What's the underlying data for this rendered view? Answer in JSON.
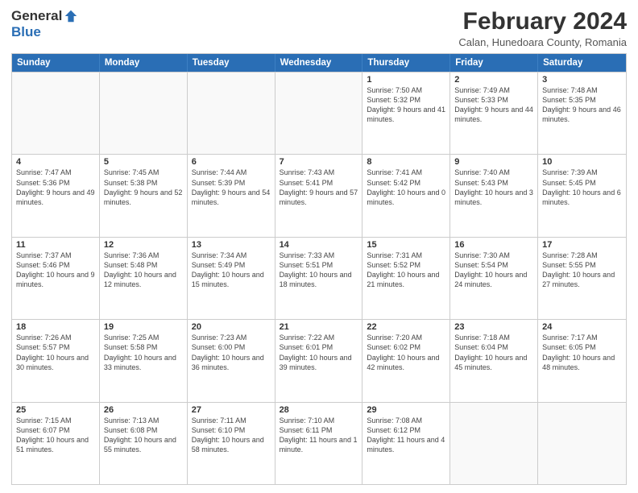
{
  "logo": {
    "general": "General",
    "blue": "Blue"
  },
  "header": {
    "month": "February 2024",
    "location": "Calan, Hunedoara County, Romania"
  },
  "weekdays": [
    "Sunday",
    "Monday",
    "Tuesday",
    "Wednesday",
    "Thursday",
    "Friday",
    "Saturday"
  ],
  "weeks": [
    [
      {
        "day": "",
        "info": ""
      },
      {
        "day": "",
        "info": ""
      },
      {
        "day": "",
        "info": ""
      },
      {
        "day": "",
        "info": ""
      },
      {
        "day": "1",
        "info": "Sunrise: 7:50 AM\nSunset: 5:32 PM\nDaylight: 9 hours and 41 minutes."
      },
      {
        "day": "2",
        "info": "Sunrise: 7:49 AM\nSunset: 5:33 PM\nDaylight: 9 hours and 44 minutes."
      },
      {
        "day": "3",
        "info": "Sunrise: 7:48 AM\nSunset: 5:35 PM\nDaylight: 9 hours and 46 minutes."
      }
    ],
    [
      {
        "day": "4",
        "info": "Sunrise: 7:47 AM\nSunset: 5:36 PM\nDaylight: 9 hours and 49 minutes."
      },
      {
        "day": "5",
        "info": "Sunrise: 7:45 AM\nSunset: 5:38 PM\nDaylight: 9 hours and 52 minutes."
      },
      {
        "day": "6",
        "info": "Sunrise: 7:44 AM\nSunset: 5:39 PM\nDaylight: 9 hours and 54 minutes."
      },
      {
        "day": "7",
        "info": "Sunrise: 7:43 AM\nSunset: 5:41 PM\nDaylight: 9 hours and 57 minutes."
      },
      {
        "day": "8",
        "info": "Sunrise: 7:41 AM\nSunset: 5:42 PM\nDaylight: 10 hours and 0 minutes."
      },
      {
        "day": "9",
        "info": "Sunrise: 7:40 AM\nSunset: 5:43 PM\nDaylight: 10 hours and 3 minutes."
      },
      {
        "day": "10",
        "info": "Sunrise: 7:39 AM\nSunset: 5:45 PM\nDaylight: 10 hours and 6 minutes."
      }
    ],
    [
      {
        "day": "11",
        "info": "Sunrise: 7:37 AM\nSunset: 5:46 PM\nDaylight: 10 hours and 9 minutes."
      },
      {
        "day": "12",
        "info": "Sunrise: 7:36 AM\nSunset: 5:48 PM\nDaylight: 10 hours and 12 minutes."
      },
      {
        "day": "13",
        "info": "Sunrise: 7:34 AM\nSunset: 5:49 PM\nDaylight: 10 hours and 15 minutes."
      },
      {
        "day": "14",
        "info": "Sunrise: 7:33 AM\nSunset: 5:51 PM\nDaylight: 10 hours and 18 minutes."
      },
      {
        "day": "15",
        "info": "Sunrise: 7:31 AM\nSunset: 5:52 PM\nDaylight: 10 hours and 21 minutes."
      },
      {
        "day": "16",
        "info": "Sunrise: 7:30 AM\nSunset: 5:54 PM\nDaylight: 10 hours and 24 minutes."
      },
      {
        "day": "17",
        "info": "Sunrise: 7:28 AM\nSunset: 5:55 PM\nDaylight: 10 hours and 27 minutes."
      }
    ],
    [
      {
        "day": "18",
        "info": "Sunrise: 7:26 AM\nSunset: 5:57 PM\nDaylight: 10 hours and 30 minutes."
      },
      {
        "day": "19",
        "info": "Sunrise: 7:25 AM\nSunset: 5:58 PM\nDaylight: 10 hours and 33 minutes."
      },
      {
        "day": "20",
        "info": "Sunrise: 7:23 AM\nSunset: 6:00 PM\nDaylight: 10 hours and 36 minutes."
      },
      {
        "day": "21",
        "info": "Sunrise: 7:22 AM\nSunset: 6:01 PM\nDaylight: 10 hours and 39 minutes."
      },
      {
        "day": "22",
        "info": "Sunrise: 7:20 AM\nSunset: 6:02 PM\nDaylight: 10 hours and 42 minutes."
      },
      {
        "day": "23",
        "info": "Sunrise: 7:18 AM\nSunset: 6:04 PM\nDaylight: 10 hours and 45 minutes."
      },
      {
        "day": "24",
        "info": "Sunrise: 7:17 AM\nSunset: 6:05 PM\nDaylight: 10 hours and 48 minutes."
      }
    ],
    [
      {
        "day": "25",
        "info": "Sunrise: 7:15 AM\nSunset: 6:07 PM\nDaylight: 10 hours and 51 minutes."
      },
      {
        "day": "26",
        "info": "Sunrise: 7:13 AM\nSunset: 6:08 PM\nDaylight: 10 hours and 55 minutes."
      },
      {
        "day": "27",
        "info": "Sunrise: 7:11 AM\nSunset: 6:10 PM\nDaylight: 10 hours and 58 minutes."
      },
      {
        "day": "28",
        "info": "Sunrise: 7:10 AM\nSunset: 6:11 PM\nDaylight: 11 hours and 1 minute."
      },
      {
        "day": "29",
        "info": "Sunrise: 7:08 AM\nSunset: 6:12 PM\nDaylight: 11 hours and 4 minutes."
      },
      {
        "day": "",
        "info": ""
      },
      {
        "day": "",
        "info": ""
      }
    ]
  ]
}
